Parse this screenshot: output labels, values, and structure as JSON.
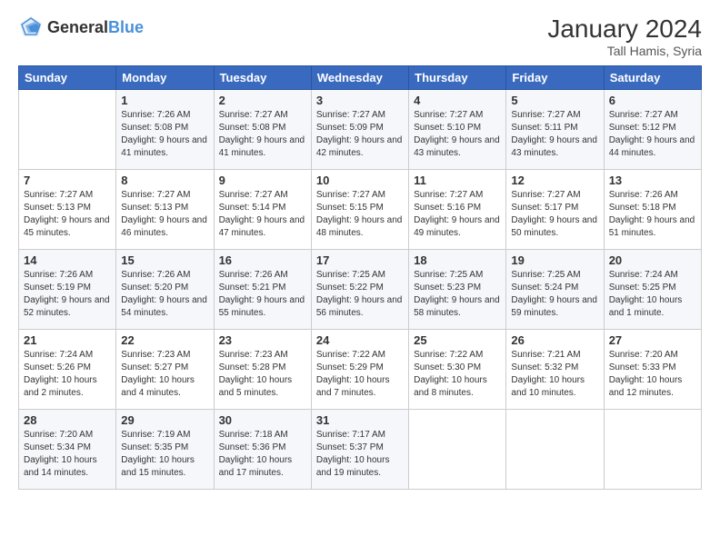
{
  "header": {
    "logo_general": "General",
    "logo_blue": "Blue",
    "month_year": "January 2024",
    "location": "Tall Hamis, Syria"
  },
  "days_of_week": [
    "Sunday",
    "Monday",
    "Tuesday",
    "Wednesday",
    "Thursday",
    "Friday",
    "Saturday"
  ],
  "weeks": [
    [
      {
        "day": "",
        "sunrise": "",
        "sunset": "",
        "daylight": "",
        "empty": true
      },
      {
        "day": "1",
        "sunrise": "7:26 AM",
        "sunset": "5:08 PM",
        "daylight": "9 hours and 41 minutes."
      },
      {
        "day": "2",
        "sunrise": "7:27 AM",
        "sunset": "5:08 PM",
        "daylight": "9 hours and 41 minutes."
      },
      {
        "day": "3",
        "sunrise": "7:27 AM",
        "sunset": "5:09 PM",
        "daylight": "9 hours and 42 minutes."
      },
      {
        "day": "4",
        "sunrise": "7:27 AM",
        "sunset": "5:10 PM",
        "daylight": "9 hours and 43 minutes."
      },
      {
        "day": "5",
        "sunrise": "7:27 AM",
        "sunset": "5:11 PM",
        "daylight": "9 hours and 43 minutes."
      },
      {
        "day": "6",
        "sunrise": "7:27 AM",
        "sunset": "5:12 PM",
        "daylight": "9 hours and 44 minutes."
      }
    ],
    [
      {
        "day": "7",
        "sunrise": "7:27 AM",
        "sunset": "5:13 PM",
        "daylight": "9 hours and 45 minutes."
      },
      {
        "day": "8",
        "sunrise": "7:27 AM",
        "sunset": "5:13 PM",
        "daylight": "9 hours and 46 minutes."
      },
      {
        "day": "9",
        "sunrise": "7:27 AM",
        "sunset": "5:14 PM",
        "daylight": "9 hours and 47 minutes."
      },
      {
        "day": "10",
        "sunrise": "7:27 AM",
        "sunset": "5:15 PM",
        "daylight": "9 hours and 48 minutes."
      },
      {
        "day": "11",
        "sunrise": "7:27 AM",
        "sunset": "5:16 PM",
        "daylight": "9 hours and 49 minutes."
      },
      {
        "day": "12",
        "sunrise": "7:27 AM",
        "sunset": "5:17 PM",
        "daylight": "9 hours and 50 minutes."
      },
      {
        "day": "13",
        "sunrise": "7:26 AM",
        "sunset": "5:18 PM",
        "daylight": "9 hours and 51 minutes."
      }
    ],
    [
      {
        "day": "14",
        "sunrise": "7:26 AM",
        "sunset": "5:19 PM",
        "daylight": "9 hours and 52 minutes."
      },
      {
        "day": "15",
        "sunrise": "7:26 AM",
        "sunset": "5:20 PM",
        "daylight": "9 hours and 54 minutes."
      },
      {
        "day": "16",
        "sunrise": "7:26 AM",
        "sunset": "5:21 PM",
        "daylight": "9 hours and 55 minutes."
      },
      {
        "day": "17",
        "sunrise": "7:25 AM",
        "sunset": "5:22 PM",
        "daylight": "9 hours and 56 minutes."
      },
      {
        "day": "18",
        "sunrise": "7:25 AM",
        "sunset": "5:23 PM",
        "daylight": "9 hours and 58 minutes."
      },
      {
        "day": "19",
        "sunrise": "7:25 AM",
        "sunset": "5:24 PM",
        "daylight": "9 hours and 59 minutes."
      },
      {
        "day": "20",
        "sunrise": "7:24 AM",
        "sunset": "5:25 PM",
        "daylight": "10 hours and 1 minute."
      }
    ],
    [
      {
        "day": "21",
        "sunrise": "7:24 AM",
        "sunset": "5:26 PM",
        "daylight": "10 hours and 2 minutes."
      },
      {
        "day": "22",
        "sunrise": "7:23 AM",
        "sunset": "5:27 PM",
        "daylight": "10 hours and 4 minutes."
      },
      {
        "day": "23",
        "sunrise": "7:23 AM",
        "sunset": "5:28 PM",
        "daylight": "10 hours and 5 minutes."
      },
      {
        "day": "24",
        "sunrise": "7:22 AM",
        "sunset": "5:29 PM",
        "daylight": "10 hours and 7 minutes."
      },
      {
        "day": "25",
        "sunrise": "7:22 AM",
        "sunset": "5:30 PM",
        "daylight": "10 hours and 8 minutes."
      },
      {
        "day": "26",
        "sunrise": "7:21 AM",
        "sunset": "5:32 PM",
        "daylight": "10 hours and 10 minutes."
      },
      {
        "day": "27",
        "sunrise": "7:20 AM",
        "sunset": "5:33 PM",
        "daylight": "10 hours and 12 minutes."
      }
    ],
    [
      {
        "day": "28",
        "sunrise": "7:20 AM",
        "sunset": "5:34 PM",
        "daylight": "10 hours and 14 minutes."
      },
      {
        "day": "29",
        "sunrise": "7:19 AM",
        "sunset": "5:35 PM",
        "daylight": "10 hours and 15 minutes."
      },
      {
        "day": "30",
        "sunrise": "7:18 AM",
        "sunset": "5:36 PM",
        "daylight": "10 hours and 17 minutes."
      },
      {
        "day": "31",
        "sunrise": "7:17 AM",
        "sunset": "5:37 PM",
        "daylight": "10 hours and 19 minutes."
      },
      {
        "day": "",
        "sunrise": "",
        "sunset": "",
        "daylight": "",
        "empty": true
      },
      {
        "day": "",
        "sunrise": "",
        "sunset": "",
        "daylight": "",
        "empty": true
      },
      {
        "day": "",
        "sunrise": "",
        "sunset": "",
        "daylight": "",
        "empty": true
      }
    ]
  ]
}
